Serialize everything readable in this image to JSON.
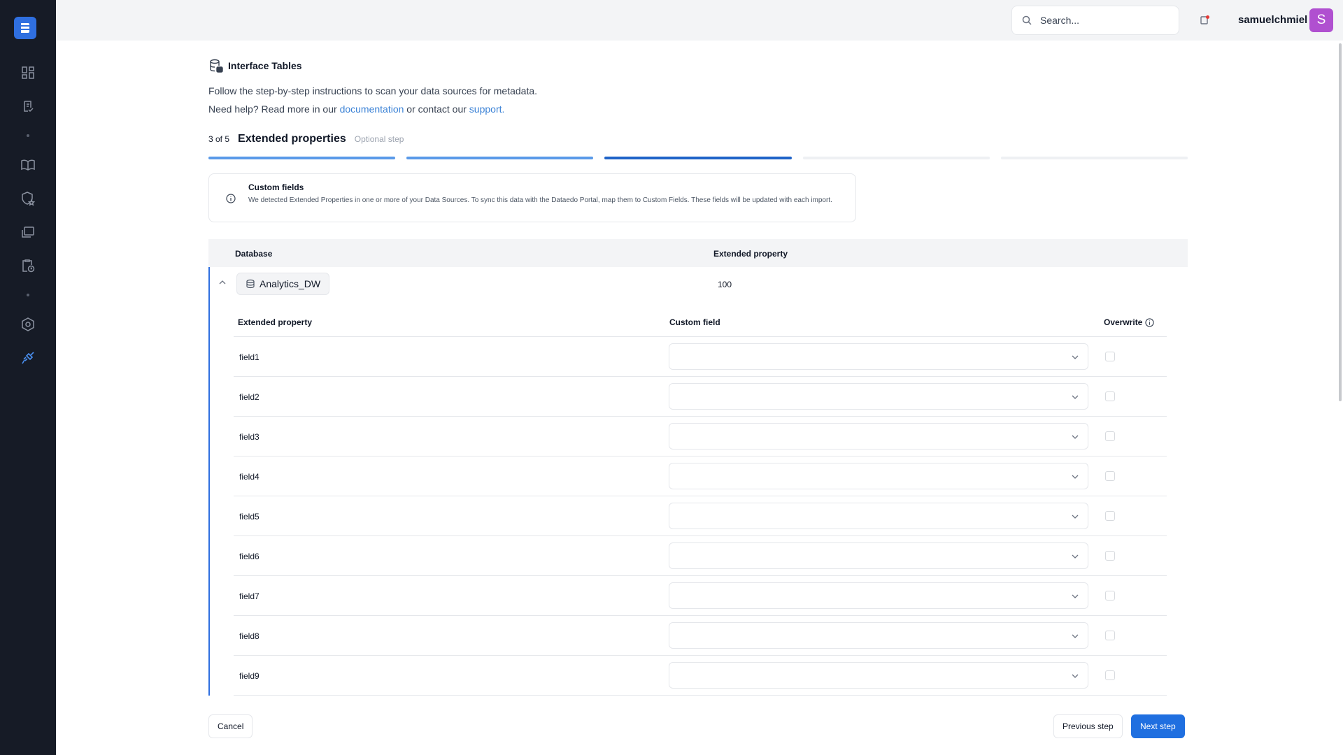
{
  "colors": {
    "accent": "#2f6fe0",
    "sidebar": "#161b26",
    "avatar": "#b050d0",
    "link": "#3b82d6"
  },
  "sidebar": {
    "logo_icon": "dataedo-logo-icon",
    "items": [
      {
        "icon": "dashboard-icon"
      },
      {
        "icon": "clipboard-check-icon"
      },
      {
        "icon": "book-icon"
      },
      {
        "icon": "shield-star-icon"
      },
      {
        "icon": "folders-icon"
      },
      {
        "icon": "clipboard-clock-icon"
      },
      {
        "icon": "settings-hexagon-icon"
      },
      {
        "icon": "connector-icon",
        "active": true
      }
    ]
  },
  "topbar": {
    "search_placeholder": "Search...",
    "username": "samuelchmiel",
    "avatar_letter": "S"
  },
  "page": {
    "title": "Interface Tables",
    "intro": "Follow the step-by-step instructions to scan your data sources for metadata.",
    "help_prefix": "Need help? Read more in our ",
    "help_link_docs": "documentation",
    "help_middle": " or contact our ",
    "help_link_support": "support."
  },
  "stepper": {
    "count": "3 of 5",
    "title": "Extended properties",
    "optional": "Optional step",
    "total": 5,
    "current": 3
  },
  "notice": {
    "title": "Custom fields",
    "text": "We detected Extended Properties in one or more of your Data Sources. To sync this data with the Dataedo Portal, map them to Custom Fields. These fields will be updated with each import."
  },
  "table": {
    "col_database": "Database",
    "col_extended": "Extended property",
    "database": {
      "name": "Analytics_DW",
      "count": "100"
    },
    "sub_cols": {
      "extended": "Extended property",
      "custom": "Custom field",
      "overwrite": "Overwrite"
    },
    "rows": [
      {
        "field": "field1",
        "custom_value": "",
        "overwrite": false
      },
      {
        "field": "field2",
        "custom_value": "",
        "overwrite": false
      },
      {
        "field": "field3",
        "custom_value": "",
        "overwrite": false
      },
      {
        "field": "field4",
        "custom_value": "",
        "overwrite": false
      },
      {
        "field": "field5",
        "custom_value": "",
        "overwrite": false
      },
      {
        "field": "field6",
        "custom_value": "",
        "overwrite": false
      },
      {
        "field": "field7",
        "custom_value": "",
        "overwrite": false
      },
      {
        "field": "field8",
        "custom_value": "",
        "overwrite": false
      },
      {
        "field": "field9",
        "custom_value": "",
        "overwrite": false
      }
    ]
  },
  "footer": {
    "cancel": "Cancel",
    "previous": "Previous step",
    "next": "Next step"
  }
}
